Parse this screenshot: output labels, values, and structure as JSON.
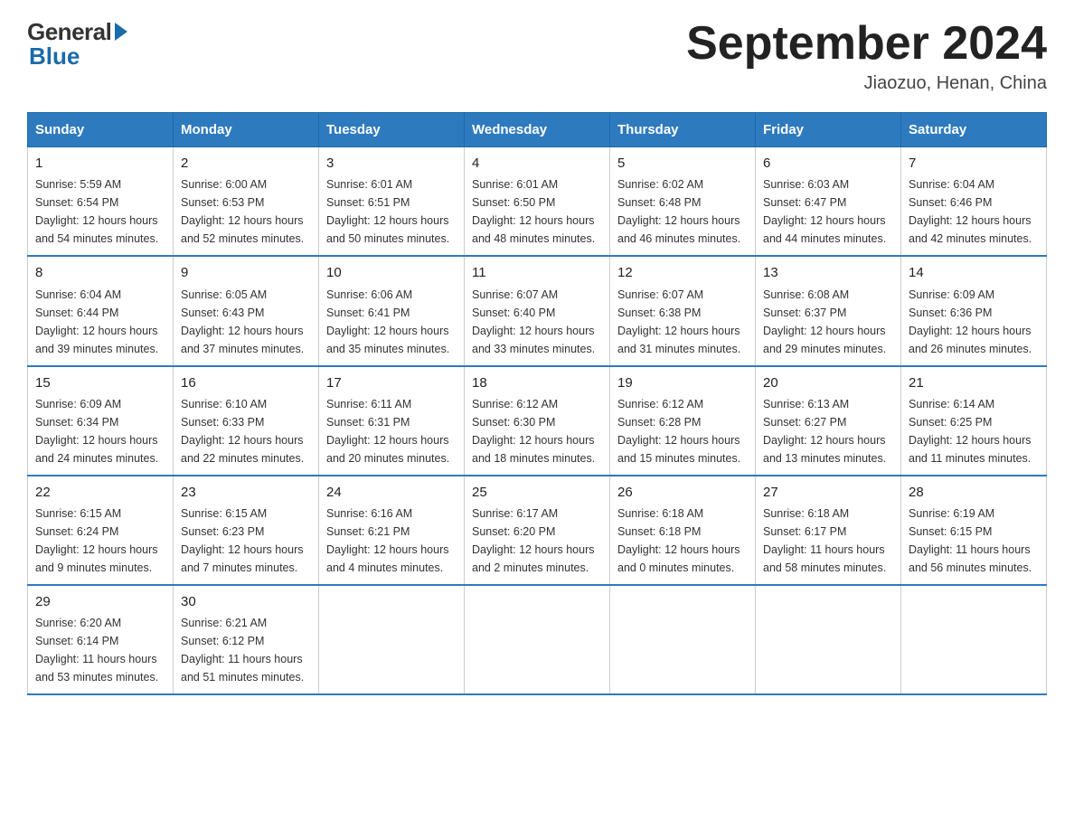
{
  "header": {
    "logo_general": "General",
    "logo_blue": "Blue",
    "month_title": "September 2024",
    "subtitle": "Jiaozuo, Henan, China"
  },
  "weekdays": [
    "Sunday",
    "Monday",
    "Tuesday",
    "Wednesday",
    "Thursday",
    "Friday",
    "Saturday"
  ],
  "weeks": [
    [
      {
        "day": "1",
        "sunrise": "5:59 AM",
        "sunset": "6:54 PM",
        "daylight": "12 hours and 54 minutes."
      },
      {
        "day": "2",
        "sunrise": "6:00 AM",
        "sunset": "6:53 PM",
        "daylight": "12 hours and 52 minutes."
      },
      {
        "day": "3",
        "sunrise": "6:01 AM",
        "sunset": "6:51 PM",
        "daylight": "12 hours and 50 minutes."
      },
      {
        "day": "4",
        "sunrise": "6:01 AM",
        "sunset": "6:50 PM",
        "daylight": "12 hours and 48 minutes."
      },
      {
        "day": "5",
        "sunrise": "6:02 AM",
        "sunset": "6:48 PM",
        "daylight": "12 hours and 46 minutes."
      },
      {
        "day": "6",
        "sunrise": "6:03 AM",
        "sunset": "6:47 PM",
        "daylight": "12 hours and 44 minutes."
      },
      {
        "day": "7",
        "sunrise": "6:04 AM",
        "sunset": "6:46 PM",
        "daylight": "12 hours and 42 minutes."
      }
    ],
    [
      {
        "day": "8",
        "sunrise": "6:04 AM",
        "sunset": "6:44 PM",
        "daylight": "12 hours and 39 minutes."
      },
      {
        "day": "9",
        "sunrise": "6:05 AM",
        "sunset": "6:43 PM",
        "daylight": "12 hours and 37 minutes."
      },
      {
        "day": "10",
        "sunrise": "6:06 AM",
        "sunset": "6:41 PM",
        "daylight": "12 hours and 35 minutes."
      },
      {
        "day": "11",
        "sunrise": "6:07 AM",
        "sunset": "6:40 PM",
        "daylight": "12 hours and 33 minutes."
      },
      {
        "day": "12",
        "sunrise": "6:07 AM",
        "sunset": "6:38 PM",
        "daylight": "12 hours and 31 minutes."
      },
      {
        "day": "13",
        "sunrise": "6:08 AM",
        "sunset": "6:37 PM",
        "daylight": "12 hours and 29 minutes."
      },
      {
        "day": "14",
        "sunrise": "6:09 AM",
        "sunset": "6:36 PM",
        "daylight": "12 hours and 26 minutes."
      }
    ],
    [
      {
        "day": "15",
        "sunrise": "6:09 AM",
        "sunset": "6:34 PM",
        "daylight": "12 hours and 24 minutes."
      },
      {
        "day": "16",
        "sunrise": "6:10 AM",
        "sunset": "6:33 PM",
        "daylight": "12 hours and 22 minutes."
      },
      {
        "day": "17",
        "sunrise": "6:11 AM",
        "sunset": "6:31 PM",
        "daylight": "12 hours and 20 minutes."
      },
      {
        "day": "18",
        "sunrise": "6:12 AM",
        "sunset": "6:30 PM",
        "daylight": "12 hours and 18 minutes."
      },
      {
        "day": "19",
        "sunrise": "6:12 AM",
        "sunset": "6:28 PM",
        "daylight": "12 hours and 15 minutes."
      },
      {
        "day": "20",
        "sunrise": "6:13 AM",
        "sunset": "6:27 PM",
        "daylight": "12 hours and 13 minutes."
      },
      {
        "day": "21",
        "sunrise": "6:14 AM",
        "sunset": "6:25 PM",
        "daylight": "12 hours and 11 minutes."
      }
    ],
    [
      {
        "day": "22",
        "sunrise": "6:15 AM",
        "sunset": "6:24 PM",
        "daylight": "12 hours and 9 minutes."
      },
      {
        "day": "23",
        "sunrise": "6:15 AM",
        "sunset": "6:23 PM",
        "daylight": "12 hours and 7 minutes."
      },
      {
        "day": "24",
        "sunrise": "6:16 AM",
        "sunset": "6:21 PM",
        "daylight": "12 hours and 4 minutes."
      },
      {
        "day": "25",
        "sunrise": "6:17 AM",
        "sunset": "6:20 PM",
        "daylight": "12 hours and 2 minutes."
      },
      {
        "day": "26",
        "sunrise": "6:18 AM",
        "sunset": "6:18 PM",
        "daylight": "12 hours and 0 minutes."
      },
      {
        "day": "27",
        "sunrise": "6:18 AM",
        "sunset": "6:17 PM",
        "daylight": "11 hours and 58 minutes."
      },
      {
        "day": "28",
        "sunrise": "6:19 AM",
        "sunset": "6:15 PM",
        "daylight": "11 hours and 56 minutes."
      }
    ],
    [
      {
        "day": "29",
        "sunrise": "6:20 AM",
        "sunset": "6:14 PM",
        "daylight": "11 hours and 53 minutes."
      },
      {
        "day": "30",
        "sunrise": "6:21 AM",
        "sunset": "6:12 PM",
        "daylight": "11 hours and 51 minutes."
      },
      null,
      null,
      null,
      null,
      null
    ]
  ],
  "labels": {
    "sunrise": "Sunrise:",
    "sunset": "Sunset:",
    "daylight": "Daylight:"
  }
}
